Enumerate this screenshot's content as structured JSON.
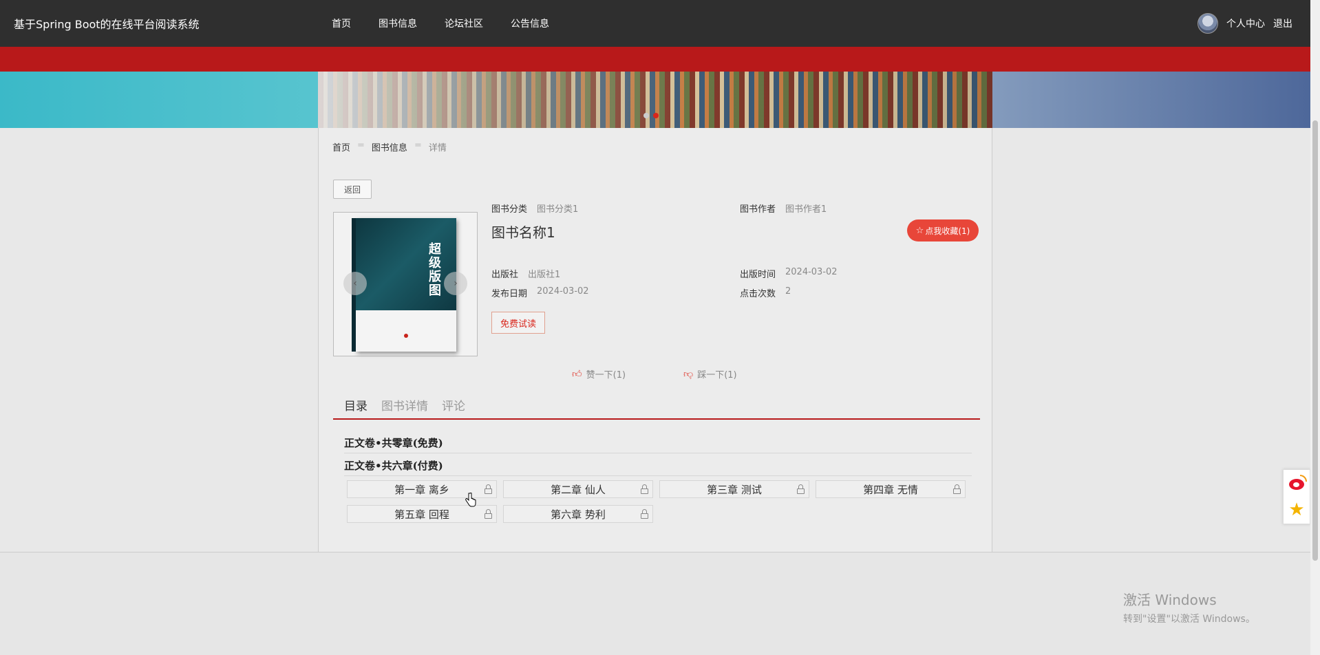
{
  "header": {
    "site_title": "基于Spring Boot的在线平台阅读系统",
    "nav": [
      "首页",
      "图书信息",
      "论坛社区",
      "公告信息"
    ],
    "user_center": "个人中心",
    "logout": "退出"
  },
  "banner": {
    "slide_count": 2,
    "active_slide": 2
  },
  "breadcrumb": {
    "home": "首页",
    "sep": "=",
    "books": "图书信息",
    "current": "详情"
  },
  "back_label": "返回",
  "book": {
    "name": "图书名称1",
    "favorite_label": "点我收藏(1)",
    "fields": [
      {
        "key": "图书分类",
        "value": "图书分类1"
      },
      {
        "key": "图书作者",
        "value": "图书作者1"
      },
      {
        "key": "出版社",
        "value": "出版社1"
      },
      {
        "key": "出版时间",
        "value": "2024-03-02"
      },
      {
        "key": "发布日期",
        "value": "2024-03-02"
      },
      {
        "key": "点击次数",
        "value": "2"
      }
    ],
    "trial_label": "免费试读",
    "cover_title": "超级版图"
  },
  "votes": {
    "like": "赞一下(1)",
    "dislike": "踩一下(1)"
  },
  "tabs": [
    "目录",
    "图书详情",
    "评论"
  ],
  "volumes": {
    "free": "正文卷•共零章(免费)",
    "paid": "正文卷•共六章(付费)"
  },
  "chapters": [
    "第一章 离乡",
    "第二章 仙人",
    "第三章 测试",
    "第四章 无情",
    "第五章 回程",
    "第六章 势利"
  ],
  "watermark": {
    "line1": "激活 Windows",
    "line2": "转到\"设置\"以激活 Windows。"
  },
  "colors": {
    "accent": "#b8191a",
    "fav": "#e84639",
    "topbar": "#2f2f2f"
  },
  "icons": {
    "like": "thumb-up-icon",
    "dislike": "thumb-down-icon",
    "lock": "lock-icon",
    "weibo": "weibo-icon",
    "favorite": "star-icon"
  }
}
